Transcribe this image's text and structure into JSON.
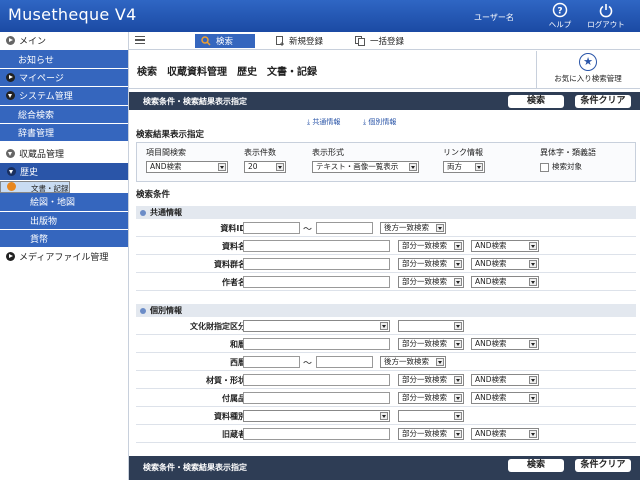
{
  "header": {
    "title": "Musetheque V4",
    "user": "ユーザー名",
    "help": "ヘルプ",
    "logout": "ログアウト"
  },
  "sidebar": {
    "items": [
      {
        "label": "メイン"
      },
      {
        "label": "お知らせ"
      },
      {
        "label": "マイページ"
      },
      {
        "label": "システム管理"
      },
      {
        "label": "総合検索"
      },
      {
        "label": "辞書管理"
      },
      {
        "label": "収蔵品管理"
      },
      {
        "label": "歴史"
      },
      {
        "label": "文書・記録"
      },
      {
        "label": "絵図・地図"
      },
      {
        "label": "出版物"
      },
      {
        "label": "貨幣"
      },
      {
        "label": "メディアファイル管理"
      }
    ]
  },
  "tabs": {
    "search": "検索",
    "new": "新規登録",
    "bulk": "一括登録"
  },
  "page": {
    "title": "検索　収蔵資料管理　歴史　文書・記録",
    "favorite": "お気に入り検索管理"
  },
  "bar": {
    "title": "検索条件・検索結果表示指定",
    "search": "検索",
    "clear": "条件クリア"
  },
  "links": {
    "common": "共通情報",
    "individual": "個別情報"
  },
  "result_settings": {
    "title": "検索結果表示指定",
    "col1": {
      "header": "項目間検索",
      "value": "AND検索"
    },
    "col2": {
      "header": "表示件数",
      "value": "20"
    },
    "col3": {
      "header": "表示形式",
      "value": "テキスト・画像一覧表示"
    },
    "col4": {
      "header": "リンク情報",
      "value": "両方"
    },
    "col5": {
      "header": "異体字・類義語",
      "check": "検索対象"
    }
  },
  "conditions_title": "検索条件",
  "common": {
    "title": "共通情報",
    "rows": [
      {
        "label": "資料ID",
        "tilde": "～",
        "match": "後方一致検索"
      },
      {
        "label": "資料名",
        "match": "部分一致検索",
        "op": "AND検索"
      },
      {
        "label": "資料群名",
        "match": "部分一致検索",
        "op": "AND検索"
      },
      {
        "label": "作者名",
        "match": "部分一致検索",
        "op": "AND検索"
      }
    ]
  },
  "individual": {
    "title": "個別情報",
    "rows": [
      {
        "label": "文化財指定区分"
      },
      {
        "label": "和暦",
        "match": "部分一致検索",
        "op": "AND検索"
      },
      {
        "label": "西暦",
        "tilde": "～",
        "match": "後方一致検索"
      },
      {
        "label": "材質・形状",
        "match": "部分一致検索",
        "op": "AND検索"
      },
      {
        "label": "付属品",
        "match": "部分一致検索",
        "op": "AND検索"
      },
      {
        "label": "資料種別"
      },
      {
        "label": "旧蔵者",
        "match": "部分一致検索",
        "op": "AND検索"
      }
    ]
  }
}
